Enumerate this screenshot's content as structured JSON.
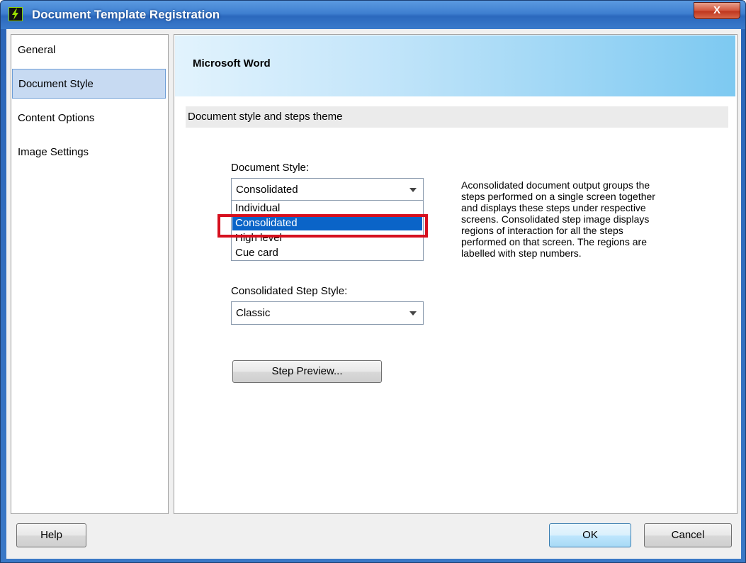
{
  "window": {
    "title": "Document Template Registration",
    "close_glyph": "X"
  },
  "sidebar": {
    "items": [
      {
        "label": "General"
      },
      {
        "label": "Document Style"
      },
      {
        "label": "Content Options"
      },
      {
        "label": "Image Settings"
      }
    ],
    "selected": "Document Style"
  },
  "banner": {
    "title": "Microsoft Word"
  },
  "section": {
    "title": "Document style and steps theme"
  },
  "document_style": {
    "label": "Document Style:",
    "value": "Consolidated",
    "options": [
      "Individual",
      "Consolidated",
      "High level",
      "Cue card"
    ],
    "highlighted": "Consolidated"
  },
  "step_style": {
    "label": "Consolidated Step Style:",
    "value": "Classic"
  },
  "description": {
    "lines": [
      "Aconsolidated document output groups the",
      "steps performed on a single screen together",
      "and displays these steps under respective",
      "screens. Consolidated step image displays",
      "regions of interaction for all the steps",
      "performed on that screen. The regions are",
      "labelled with step numbers."
    ]
  },
  "buttons": {
    "step_preview": "Step Preview...",
    "help": "Help",
    "ok": "OK",
    "cancel": "Cancel"
  },
  "colors": {
    "selection": "#0a64c8",
    "highlight_box": "#d6101e",
    "sidebar_selected": "#c7daf2"
  }
}
